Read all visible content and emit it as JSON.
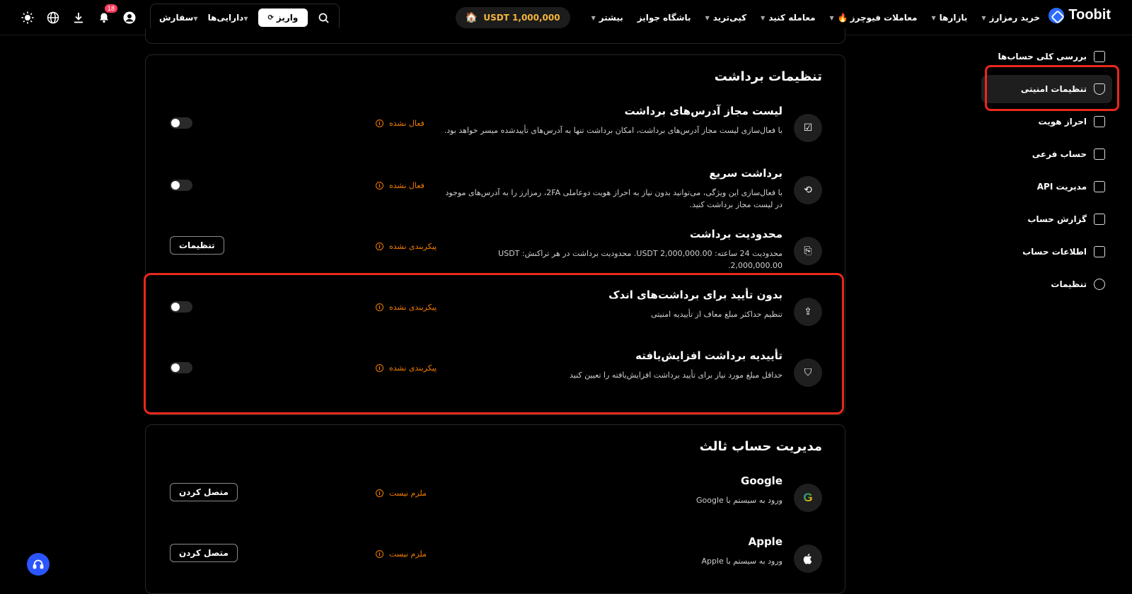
{
  "topbar": {
    "brand": "Toobit",
    "nav": [
      {
        "label": "خرید رمزارز",
        "caret": true
      },
      {
        "label": "بازارها",
        "caret": true
      },
      {
        "label": "معاملات فیوچرز",
        "caret": true
      },
      {
        "label": "معامله کنید",
        "caret": true
      },
      {
        "label": "کپی‌ترید",
        "caret": true
      },
      {
        "label": "باشگاه جوایز",
        "caret": false
      },
      {
        "label": "بیشتر",
        "caret": true
      }
    ],
    "balance": "USDT 1,000,000",
    "deposit_label": "واریز",
    "assets_label": "دارایی‌ها",
    "orders_label": "سفارش",
    "notification_count": "18"
  },
  "sidebar": {
    "items": [
      {
        "label": "بررسی کلی حساب‌ها",
        "icon": "grid-icon"
      },
      {
        "label": "تنظیمات امنیتی",
        "icon": "shield-icon"
      },
      {
        "label": "احراز هویت",
        "icon": "id-card-icon"
      },
      {
        "label": "حساب فرعی",
        "icon": "sub-account-icon"
      },
      {
        "label": "مدیریت API",
        "icon": "api-icon"
      },
      {
        "label": "گزارش حساب",
        "icon": "report-icon"
      },
      {
        "label": "اطلاعات حساب",
        "icon": "user-icon"
      },
      {
        "label": "تنظیمات",
        "icon": "gear-icon"
      }
    ]
  },
  "withdraw": {
    "title": "تنظیمات برداشت",
    "rows": [
      {
        "title": "لیست مجاز آدرس‌های برداشت",
        "desc": "با فعال‌سازی لیست مجاز آدرس‌های برداشت، امکان برداشت تنها به آدرس‌های تأییدشده میسر خواهد بود.",
        "status": "فعال نشده"
      },
      {
        "title": "برداشت سریع",
        "desc": "با فعال‌سازی این ویژگی، می‌توانید بدون نیاز به احراز هویت دوعاملی 2FA، رمزارز را به آدرس‌های موجود در لیست مجاز برداشت کنید.",
        "status": "فعال نشده"
      },
      {
        "title": "محدودیت برداشت",
        "desc": "محدودیت 24 ساعته: USDT 2,000,000.00. محدودیت برداشت در هر تراکنش: USDT 2,000,000.00.",
        "status": "پیکربندی نشده",
        "button": "تنظیمات"
      },
      {
        "title": "بدون تأیید برای برداشت‌های اندک",
        "desc": "تنظیم حداکثر مبلغ معاف از تأییدیه امنیتی",
        "status": "پیکربندی نشده"
      },
      {
        "title": "تأییدیه برداشت افزایش‌یافته",
        "desc": "حداقل مبلغ مورد نیاز برای تأیید برداشت افزایش‌یافته را تعیین کنید",
        "status": "پیکربندی نشده"
      }
    ]
  },
  "third_party": {
    "title": "مدیریت حساب ثالث",
    "rows": [
      {
        "title": "Google",
        "desc": "ورود به سیستم با Google",
        "status": "ملزم نیست",
        "button": "متصل کردن"
      },
      {
        "title": "Apple",
        "desc": "ورود به سیستم با Apple",
        "status": "ملزم نیست",
        "button": "متصل کردن"
      }
    ]
  },
  "colors": {
    "accent": "#2b6cff",
    "warning": "#f57c00",
    "highlight": "#e8291c",
    "balance": "#f5b53d"
  }
}
